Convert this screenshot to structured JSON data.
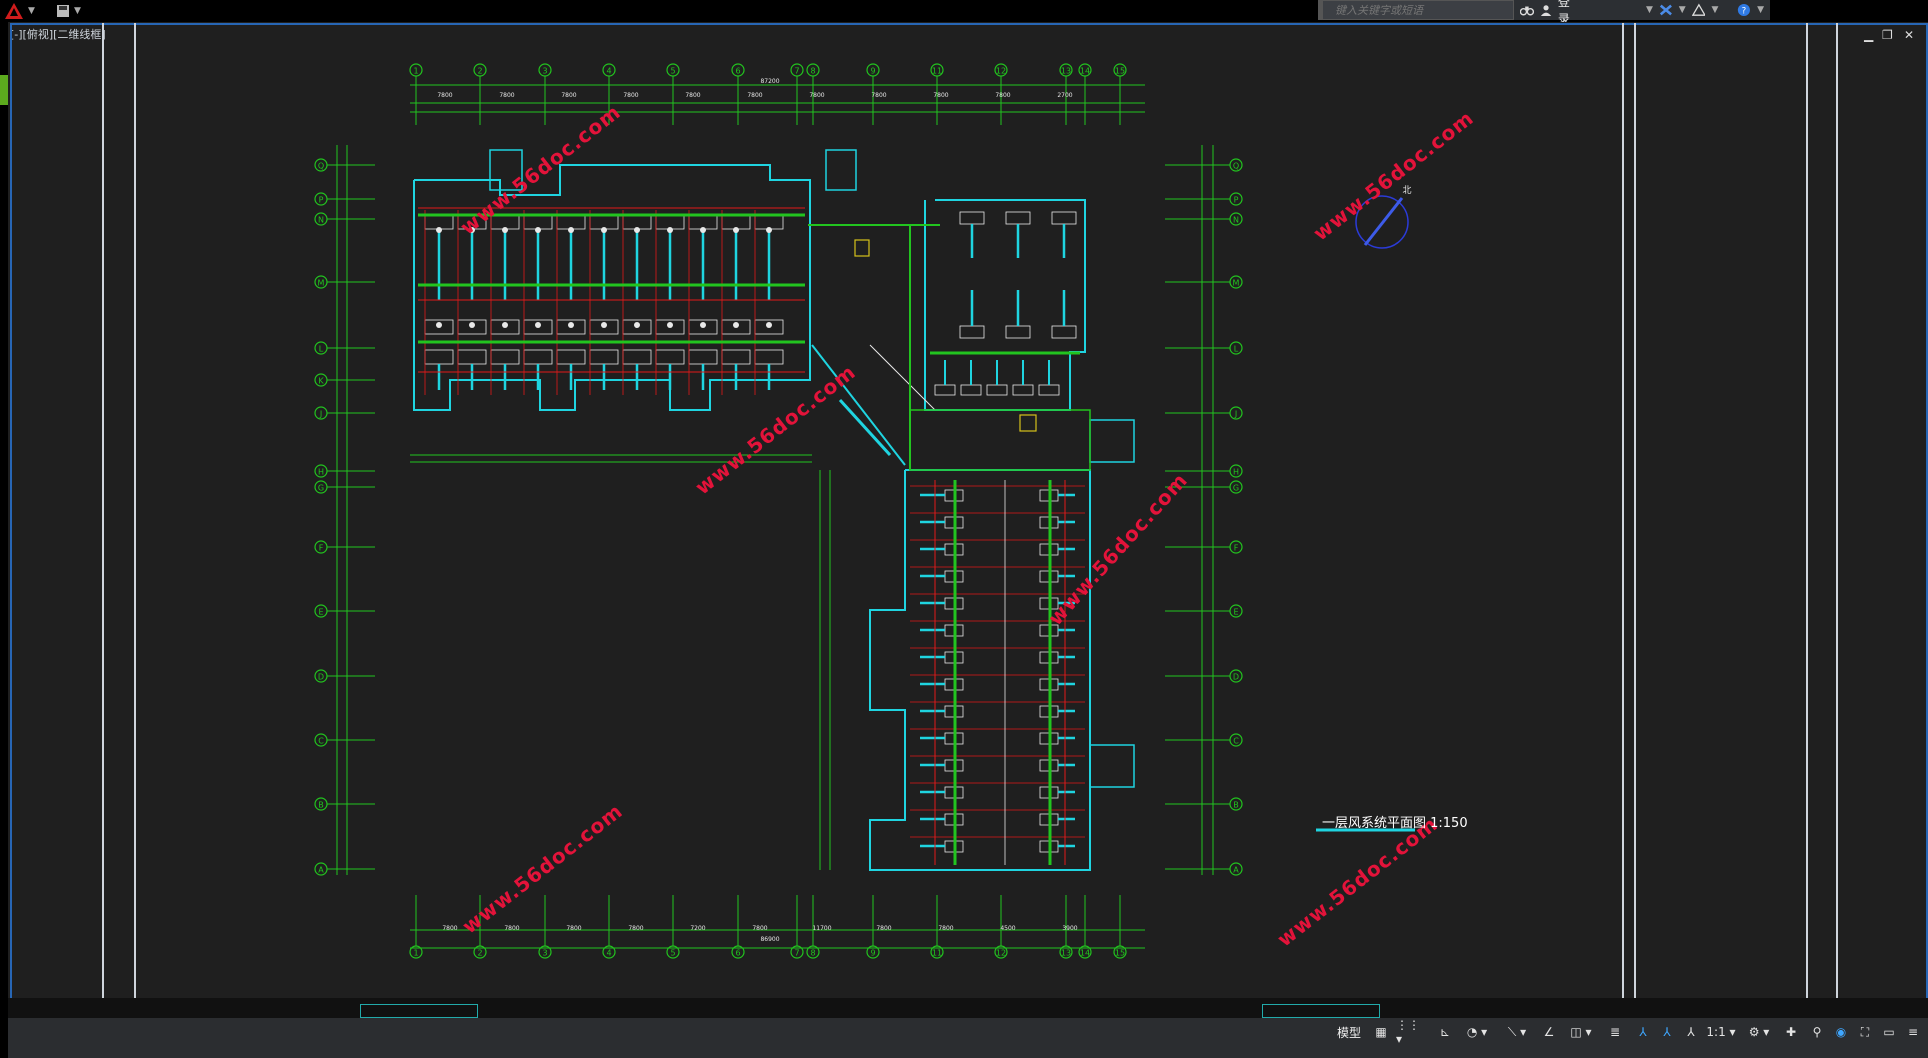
{
  "app": {
    "viewport_label": "[-][俯视][二维线框]",
    "search_placeholder": "键入关键字或短语",
    "login_label": "登录"
  },
  "drawing": {
    "title": "一层风系统平面图 1:150",
    "watermark": "www.56doc.com",
    "column_labels": [
      "1",
      "2",
      "3",
      "4",
      "5",
      "6",
      "7",
      "8",
      "9",
      "11",
      "12",
      "13",
      "14",
      "15"
    ],
    "row_labels_left": [
      "Q",
      "P",
      "N",
      "M",
      "L",
      "K",
      "J",
      "H",
      "G",
      "F",
      "E",
      "D",
      "C",
      "B",
      "A"
    ],
    "row_labels_right": [
      "Q",
      "P",
      "N",
      "M",
      "L",
      "J",
      "H",
      "G",
      "F",
      "E",
      "D",
      "C",
      "B",
      "A"
    ],
    "top_dims": [
      "7800",
      "7800",
      "7800",
      "7800",
      "7800",
      "7800",
      "7800",
      "7800",
      "7800",
      "7800",
      "2700"
    ],
    "total_dim": "87200",
    "bottom_dims": [
      "7800",
      "7800",
      "7800",
      "7800",
      "7200",
      "7800",
      "11700",
      "7800",
      "7800",
      "4500",
      "3900"
    ],
    "bottom_total": "86900",
    "north_label": "北"
  },
  "statusbar": {
    "model_label": "模型",
    "scale_label": "1:1"
  },
  "colors": {
    "green": "#22c41f",
    "cyan": "#1fd4e0",
    "red": "#e01a1a",
    "white": "#e8e8e8",
    "yellow": "#d6c21a",
    "blue": "#2766b5"
  }
}
